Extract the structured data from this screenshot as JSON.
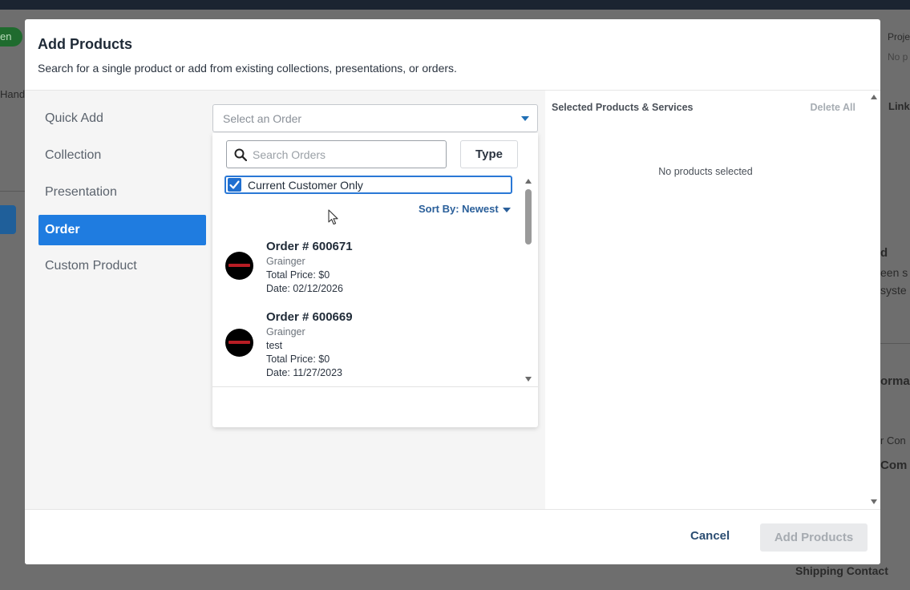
{
  "background": {
    "pill_text": "en",
    "left_text": "Hand",
    "right_texts": [
      "Proje",
      "No p",
      "Link",
      "d",
      "een s",
      "syste",
      "orma",
      "r Con",
      "Com"
    ],
    "bottom_text": "Shipping Contact"
  },
  "modal": {
    "title": "Add Products",
    "subtitle": "Search for a single product or add from existing collections, presentations, or orders."
  },
  "nav": [
    {
      "label": "Quick Add"
    },
    {
      "label": "Collection"
    },
    {
      "label": "Presentation"
    },
    {
      "label": "Order"
    },
    {
      "label": "Custom Product"
    }
  ],
  "order_select": {
    "placeholder": "Select an Order"
  },
  "dropdown": {
    "search_placeholder": "Search Orders",
    "type_label": "Type",
    "checkbox_label": "Current Customer Only",
    "checkbox_checked": true,
    "sort_label": "Sort By: Newest"
  },
  "orders": [
    {
      "title": "Order # 600671",
      "customer": "Grainger",
      "note": "",
      "price": "Total Price: $0",
      "date": "Date: 02/12/2026"
    },
    {
      "title": "Order # 600669",
      "customer": "Grainger",
      "note": "test",
      "price": "Total Price: $0",
      "date": "Date: 11/27/2023"
    }
  ],
  "selected_panel": {
    "title": "Selected Products & Services",
    "delete_all": "Delete All",
    "empty_text": "No products selected"
  },
  "footer": {
    "cancel": "Cancel",
    "add": "Add Products"
  },
  "colors": {
    "accent": "#1f7ce0",
    "link": "#2a5f9a",
    "disabled": "#a6abb1"
  }
}
